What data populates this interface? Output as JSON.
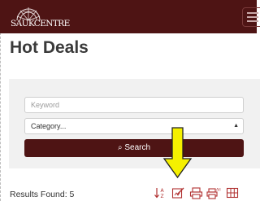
{
  "header": {
    "logo_text": "SAUKCENTRE"
  },
  "page": {
    "title": "Hot Deals"
  },
  "search": {
    "keyword_placeholder": "Keyword",
    "category_value": "Category...",
    "button_label": "Search",
    "search_icon_glyph": "⌕"
  },
  "results": {
    "label": "Results Found:",
    "count": "5"
  },
  "toolbar": {
    "icons": [
      "sort-az-icon",
      "edit-icon",
      "print-icon",
      "print-all-icon",
      "grid-view-icon"
    ]
  },
  "colors": {
    "brand": "#4e1414",
    "accent_icons": "#b03030",
    "annotation_arrow": "#f5f000"
  }
}
